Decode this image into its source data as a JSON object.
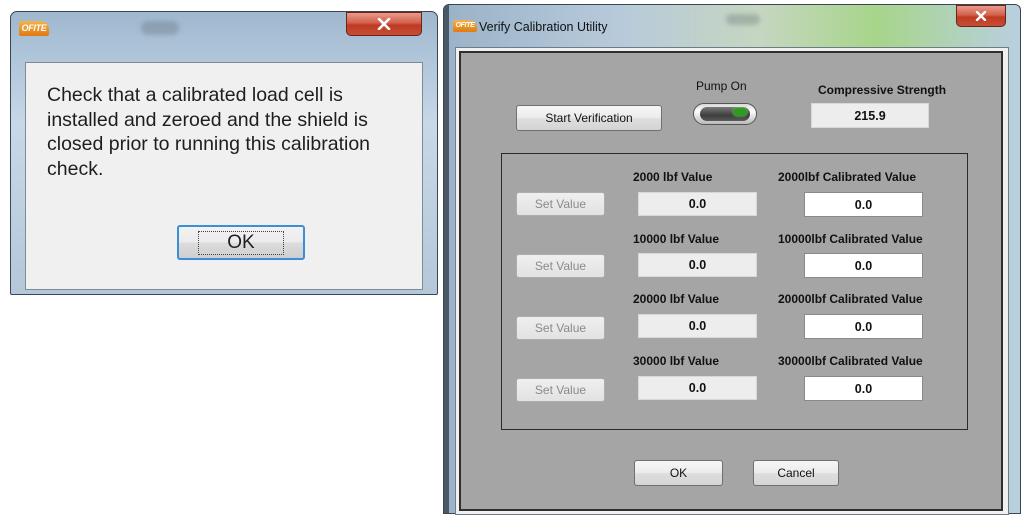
{
  "message_box": {
    "logo_text": "OFITE",
    "title": "",
    "message": "Check that a calibrated load cell is installed and zeroed and the shield is closed prior to running this calibration check.",
    "ok_label": "OK"
  },
  "verify_window": {
    "logo_text": "OFITE",
    "title": "Verify Calibration Utility",
    "start_button": "Start Verification",
    "pump_label": "Pump On",
    "pump_on": true,
    "compressive_label": "Compressive Strength",
    "compressive_value": "215.9",
    "rows": [
      {
        "set_label": "Set Value",
        "value_label": "2000 lbf Value",
        "value": "0.0",
        "cal_label": "2000lbf Calibrated Value",
        "cal_value": "0.0"
      },
      {
        "set_label": "Set Value",
        "value_label": "10000 lbf Value",
        "value": "0.0",
        "cal_label": "10000lbf Calibrated Value",
        "cal_value": "0.0"
      },
      {
        "set_label": "Set Value",
        "value_label": "20000 lbf Value",
        "value": "0.0",
        "cal_label": "20000lbf Calibrated Value",
        "cal_value": "0.0"
      },
      {
        "set_label": "Set Value",
        "value_label": "30000 lbf Value",
        "value": "0.0",
        "cal_label": "30000lbf Calibrated Value",
        "cal_value": "0.0"
      }
    ],
    "ok_label": "OK",
    "cancel_label": "Cancel"
  },
  "colors": {
    "close_button": "#c64e35",
    "panel_grey": "#a5a5a5",
    "pump_led": "#2e9b22"
  }
}
